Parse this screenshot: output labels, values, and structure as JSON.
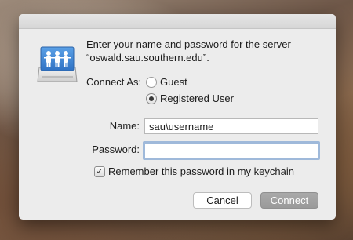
{
  "dialog": {
    "prompt_line1": "Enter your name and password for the server",
    "prompt_line2": "“oswald.sau.southern.edu”.",
    "connect_as_label": "Connect As:",
    "options": [
      {
        "label": "Guest",
        "selected": false
      },
      {
        "label": "Registered User",
        "selected": true
      }
    ],
    "name_label": "Name:",
    "name_value": "sau\\username",
    "password_label": "Password:",
    "password_value": "",
    "remember_label": "Remember this password in my keychain",
    "remember_checked": true,
    "cancel_label": "Cancel",
    "connect_label": "Connect"
  },
  "colors": {
    "dialog_bg": "#ececec",
    "focus_ring": "#9fb9da",
    "connect_button": "#9a9a9a"
  },
  "icons": [
    "server-users-icon",
    "checkmark-icon"
  ]
}
